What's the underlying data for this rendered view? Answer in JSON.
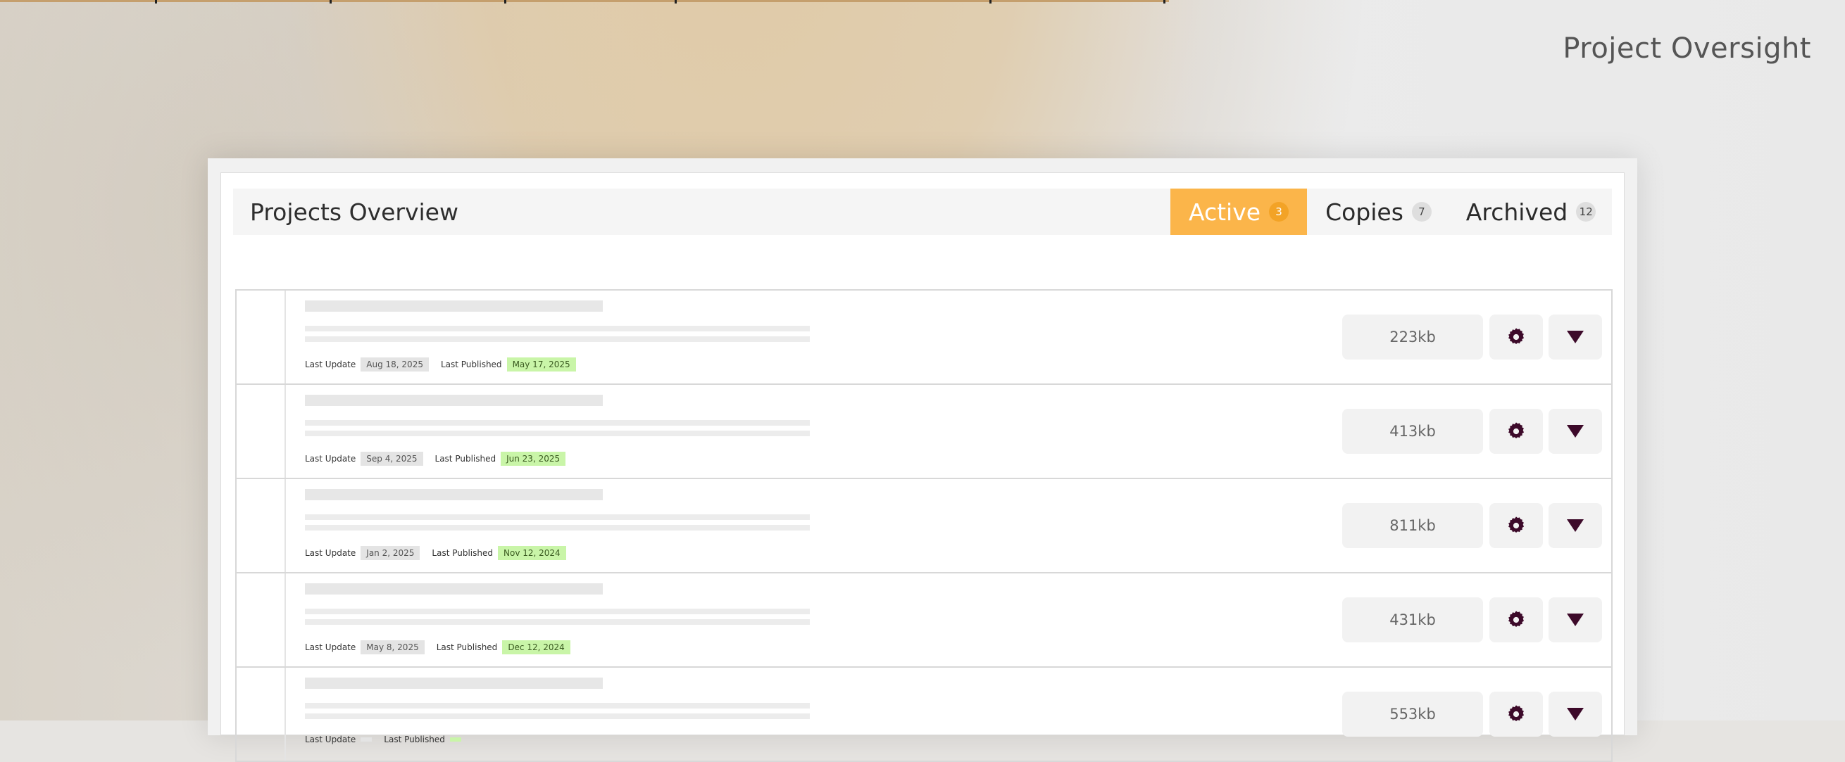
{
  "page": {
    "heading": "Project Oversight"
  },
  "overview": {
    "title": "Projects Overview",
    "tabs": [
      {
        "label": "Active",
        "count": "3",
        "active": true
      },
      {
        "label": "Copies",
        "count": "7",
        "active": false
      },
      {
        "label": "Archived",
        "count": "12",
        "active": false
      }
    ]
  },
  "labels": {
    "last_update": "Last Update",
    "last_published": "Last Published"
  },
  "projects": [
    {
      "last_update": "Aug 18, 2025",
      "last_published": "May 17, 2025",
      "size": "223kb"
    },
    {
      "last_update": "Sep 4, 2025",
      "last_published": "Jun 23, 2025",
      "size": "413kb"
    },
    {
      "last_update": "Jan 2, 2025",
      "last_published": "Nov 12, 2024",
      "size": "811kb"
    },
    {
      "last_update": "May 8, 2025",
      "last_published": "Dec 12, 2024",
      "size": "431kb"
    },
    {
      "last_update": "",
      "last_published": "",
      "size": "553kb"
    }
  ],
  "icons": {
    "settings": "gear-icon",
    "expand": "triangle-down-icon"
  },
  "colors": {
    "accent": "#fbb54a",
    "icon": "#3d0a2a",
    "published_bg": "#c9f5a8"
  }
}
